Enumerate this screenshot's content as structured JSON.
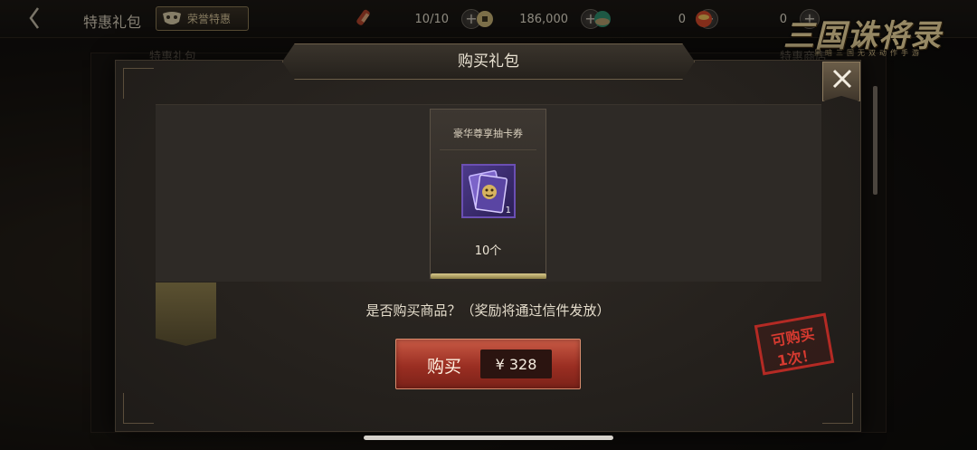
{
  "header": {
    "title": "特惠礼包",
    "honor_tab_label": "荣誉特惠",
    "resources": [
      {
        "name": "scroll",
        "value": "10/10",
        "color": "#b3452d"
      },
      {
        "name": "copper-coin",
        "value": "186,000",
        "color": "#c9b477"
      },
      {
        "name": "jade-orb",
        "value": "0",
        "color": "#2f8f6e"
      },
      {
        "name": "gold-ingot",
        "value": "0",
        "color": "#d44a2a"
      }
    ]
  },
  "logo": {
    "main_text": "三国诛将录",
    "sub_text": "黑暗三国无双动作手游"
  },
  "background": {
    "tab_left": "特惠礼包",
    "tab_right": "特惠商店"
  },
  "dialog": {
    "title": "购买礼包",
    "item": {
      "name": "豪华尊享抽卡券",
      "icon": "ticket-card-icon",
      "icon_quantity": "1",
      "count_label": "10个"
    },
    "question": "是否购买商品？（奖励将通过信件发放）",
    "buy_button": {
      "label": "购买",
      "price": "¥  328"
    },
    "stamp": {
      "line1": "可购买",
      "line2": "1次！"
    }
  },
  "colors": {
    "accent_red": "#9a2e22",
    "gold": "#d9c79c",
    "ticket_purple": "#4c3a8a"
  }
}
